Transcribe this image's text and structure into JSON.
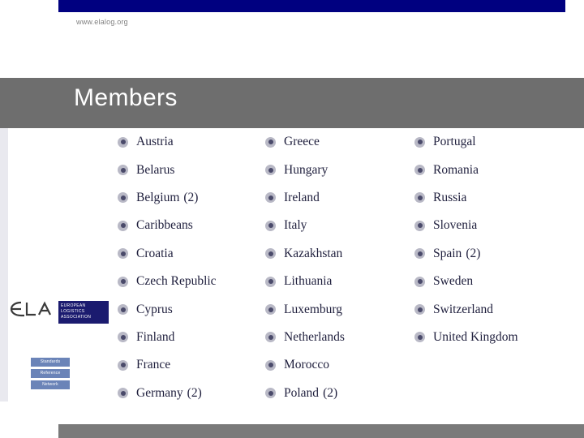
{
  "header": {
    "url": "www.elalog.org"
  },
  "title": "Members",
  "sidebar": {
    "logo_text": "ELA",
    "logo_sub_lines": "EUROPEAN LOGISTICS ASSOCIATION",
    "tags": [
      "Standards",
      "Reference",
      "Network"
    ]
  },
  "columns": [
    {
      "items": [
        {
          "name": "Austria",
          "suffix": ""
        },
        {
          "name": "Belarus",
          "suffix": ""
        },
        {
          "name": "Belgium",
          "suffix": "(2)"
        },
        {
          "name": "Caribbeans",
          "suffix": ""
        },
        {
          "name": "Croatia",
          "suffix": ""
        },
        {
          "name": "Czech Republic",
          "suffix": ""
        },
        {
          "name": "Cyprus",
          "suffix": ""
        },
        {
          "name": "Finland",
          "suffix": ""
        },
        {
          "name": "France",
          "suffix": ""
        },
        {
          "name": "Germany",
          "suffix": "(2)"
        }
      ]
    },
    {
      "items": [
        {
          "name": "Greece",
          "suffix": ""
        },
        {
          "name": "Hungary",
          "suffix": ""
        },
        {
          "name": "Ireland",
          "suffix": ""
        },
        {
          "name": "Italy",
          "suffix": ""
        },
        {
          "name": "Kazakhstan",
          "suffix": ""
        },
        {
          "name": "Lithuania",
          "suffix": ""
        },
        {
          "name": "Luxemburg",
          "suffix": ""
        },
        {
          "name": "Netherlands",
          "suffix": ""
        },
        {
          "name": "Morocco",
          "suffix": ""
        },
        {
          "name": "Poland",
          "suffix": "(2)"
        }
      ]
    },
    {
      "items": [
        {
          "name": "Portugal",
          "suffix": ""
        },
        {
          "name": "Romania",
          "suffix": ""
        },
        {
          "name": "Russia",
          "suffix": ""
        },
        {
          "name": "Slovenia",
          "suffix": ""
        },
        {
          "name": "Spain",
          "suffix": "(2)"
        },
        {
          "name": "Sweden",
          "suffix": ""
        },
        {
          "name": "Switzerland",
          "suffix": ""
        },
        {
          "name": "United Kingdom",
          "suffix": ""
        }
      ]
    }
  ],
  "colors": {
    "top_bar": "#000080",
    "title_band": "#6e6e6e",
    "bottom_bar": "#7a7a7a",
    "text": "#1f1f3d"
  }
}
